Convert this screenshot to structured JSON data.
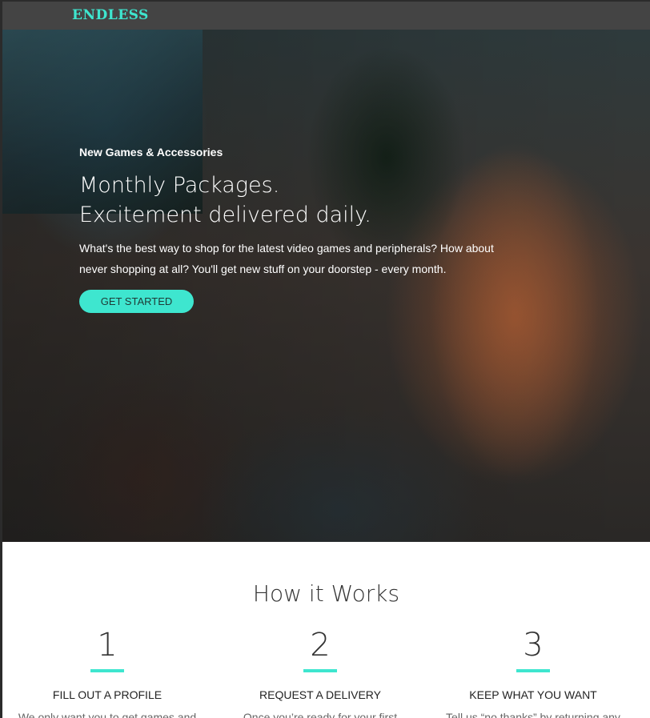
{
  "brand": {
    "logo": "ENDLESS",
    "accent": "#3ee6cf",
    "nav_bg": "#444444"
  },
  "hero": {
    "eyebrow": "New Games & Accessories",
    "title_line1": "Monthly Packages.",
    "title_line2": "Excitement delivered daily.",
    "description": "What's the best way to shop for the latest video games and peripherals? How about never shopping at all? You'll get new stuff on your doorstep - every month.",
    "cta_label": "GET STARTED"
  },
  "how_it_works": {
    "title": "How it Works",
    "steps": [
      {
        "number": "1",
        "title": "FILL OUT A PROFILE",
        "text": "We only want you to get games and"
      },
      {
        "number": "2",
        "title": "REQUEST A DELIVERY",
        "text": "Once you’re ready for your first"
      },
      {
        "number": "3",
        "title": "KEEP WHAT YOU WANT",
        "text": "Tell us “no thanks” by returning any"
      }
    ]
  }
}
